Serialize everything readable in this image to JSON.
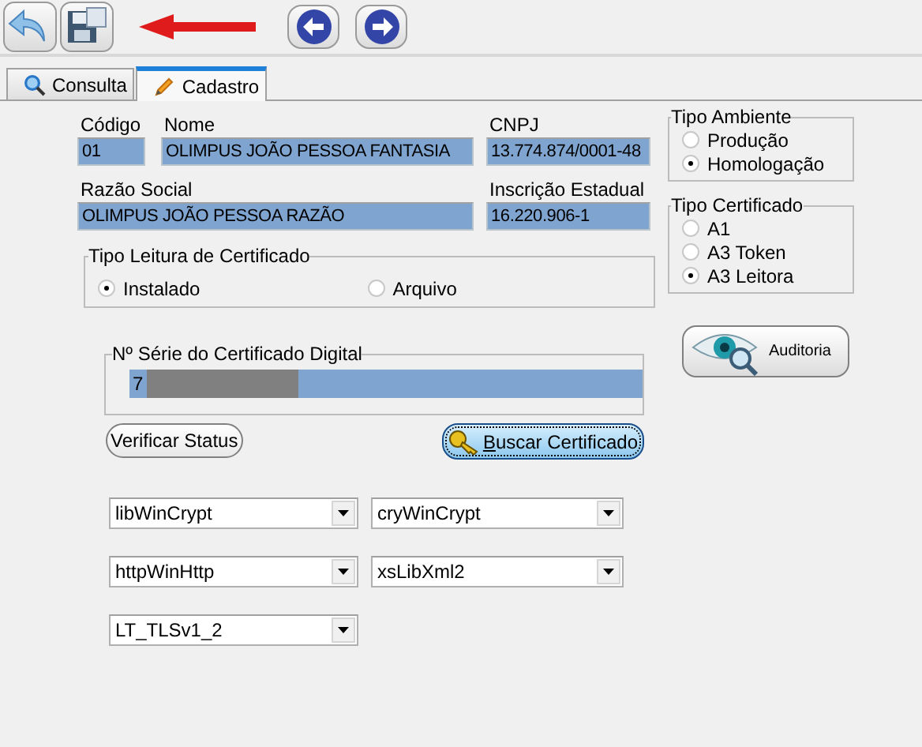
{
  "tabs": [
    {
      "label": "Consulta",
      "selected": false
    },
    {
      "label": "Cadastro",
      "selected": true
    }
  ],
  "fields_top": [
    {
      "label": "Código",
      "value": "01"
    },
    {
      "label": "Nome",
      "value": "OLIMPUS JOÃO PESSOA FANTASIA"
    },
    {
      "label": "CNPJ",
      "value": "13.774.874/0001-48"
    }
  ],
  "fields_second": [
    {
      "label": "Razão Social",
      "value": "OLIMPUS JOÃO PESSOA RAZÃO"
    },
    {
      "label": "Inscrição Estadual",
      "value": "16.220.906-1"
    }
  ],
  "tipo_leitura": {
    "title": "Tipo Leitura de Certificado",
    "options": [
      {
        "label": "Instalado",
        "selected": true
      },
      {
        "label": "Arquivo",
        "selected": false
      }
    ]
  },
  "serie": {
    "title": "Nº Série do Certificado Digital",
    "value": "7"
  },
  "verificar_button": {
    "label": "Verificar Status"
  },
  "buscar_button": {
    "label": "Buscar Certificado"
  },
  "tipo_ambiente": {
    "title": "Tipo Ambiente",
    "options": [
      {
        "label": "Produção",
        "selected": false
      },
      {
        "label": "Homologação",
        "selected": true
      }
    ]
  },
  "tipo_certificado": {
    "title": "Tipo Certificado",
    "options": [
      {
        "label": "A1",
        "selected": false
      },
      {
        "label": "A3 Token",
        "selected": false
      },
      {
        "label": "A3 Leitora",
        "selected": true
      }
    ]
  },
  "auditoria_button": {
    "label": "Auditoria"
  },
  "combos": [
    {
      "value": "libWinCrypt"
    },
    {
      "value": "cryWinCrypt"
    },
    {
      "value": "httpWinHttp"
    },
    {
      "value": "xsLibXml2"
    },
    {
      "value": "LT_TLSv1_2"
    }
  ]
}
